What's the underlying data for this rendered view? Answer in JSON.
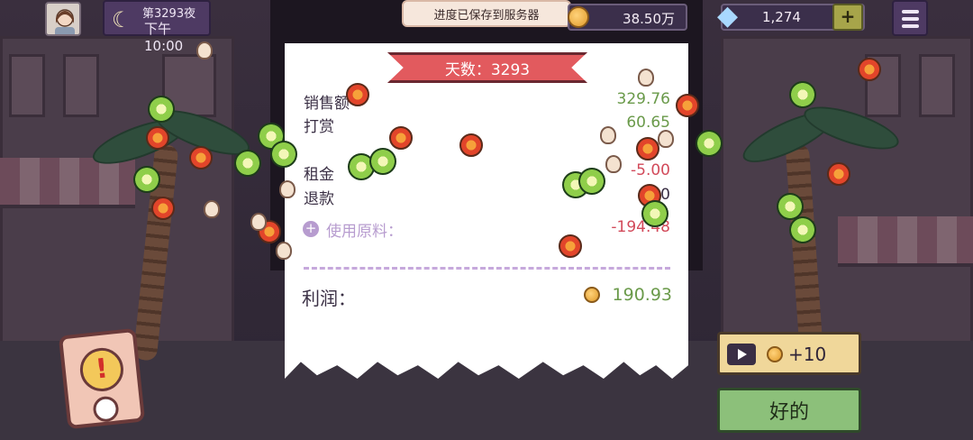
{
  "hud": {
    "night": "第3293夜",
    "time": "下午10:00",
    "coins": "38.50万",
    "gems": "1,274",
    "plus": "+"
  },
  "toast": "进度已保存到服务器",
  "receipt": {
    "day_title": "天数：3293",
    "sales_label": "销售额",
    "sales_value": "329.76",
    "tips_label": "打赏",
    "tips_value": "60.65",
    "rent_label": "租金",
    "rent_value": "-5.00",
    "refund_label": "退款",
    "refund_value": "0",
    "raw_plus": "+",
    "raw_label": "使用原料：",
    "raw_value": "-194.48",
    "profit_label": "利润：",
    "profit_value": "190.93"
  },
  "buttons": {
    "ad_reward": "+10",
    "ok": "好的"
  },
  "alert": {
    "symbol": "!"
  },
  "colors": {
    "positive": "#6a9a4a",
    "negative": "#d24a5a",
    "ribbon": "#e25a5e",
    "ok_button": "#8cc07a",
    "ad_button": "#f0d79a",
    "night_panel": "#4e3a63"
  }
}
